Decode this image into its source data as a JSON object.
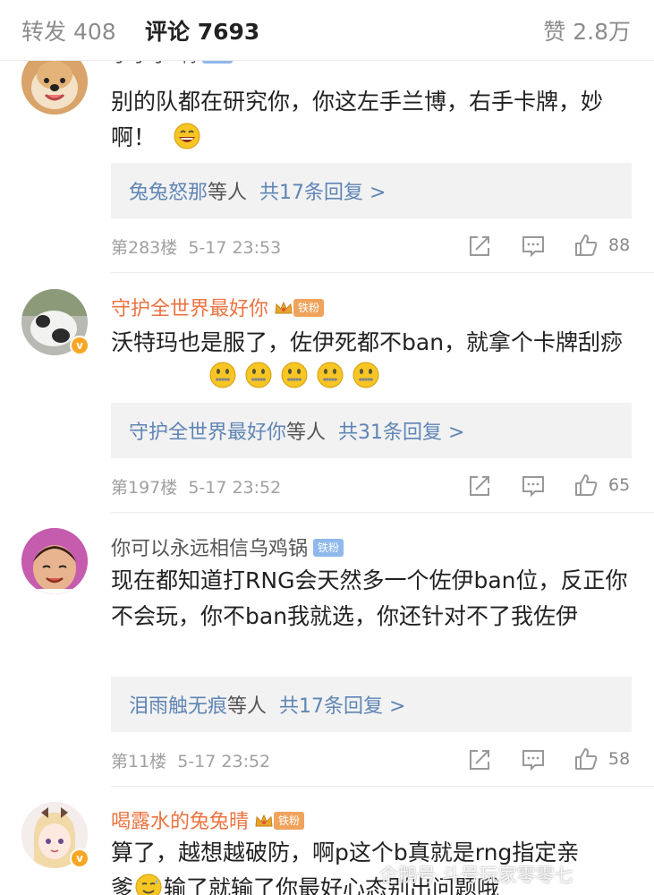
{
  "tabs": {
    "forward": "转发 408",
    "comments": "评论 7693",
    "likes": "赞 2.8万"
  },
  "comments": [
    {
      "username": "小小小-啊",
      "badge": "铁粉",
      "text": "别的队都在研究你，你这左手兰博，右手卡牌，妙啊！",
      "emoji": [
        "grin-emoji"
      ],
      "reply_names": "兔兔怒那",
      "reply_etc": "等人",
      "reply_count": "共17条回复 >",
      "floor": "第283楼",
      "time": "5-17 23:53",
      "likes": "88"
    },
    {
      "username": "守护全世界最好你",
      "badge": "铁粉",
      "text": "沃特玛也是服了，佐伊死都不ban，就拿个卡牌刮痧",
      "emoji": [
        "zipper-emoji",
        "zipper-emoji",
        "zipper-emoji",
        "zipper-emoji",
        "zipper-emoji"
      ],
      "reply_names": "守护全世界最好你",
      "reply_etc": "等人",
      "reply_count": "共31条回复 >",
      "floor": "第197楼",
      "time": "5-17 23:52",
      "likes": "65"
    },
    {
      "username": "你可以永远相信乌鸡锅",
      "badge": "铁粉",
      "text": "现在都知道打RNG会天然多一个佐伊ban位，反正你不会玩，你不ban我就选，你还针对不了我佐伊",
      "reply_names": "泪雨触无痕",
      "reply_etc": "等人",
      "reply_count": "共17条回复 >",
      "floor": "第11楼",
      "time": "5-17 23:52",
      "likes": "58"
    },
    {
      "username": "喝露水的兔兔晴",
      "badge": "铁粉",
      "text_line1": "算了，越想越破防，啊p这个b真就是rng指定亲",
      "text_line2": "爹",
      "text_line2_rest": "输了就输了你最好心态别出问题哦"
    }
  ],
  "watermark": "企鹅号 斗号玩家零零七",
  "colors": {
    "username_highlight": "#eb7340",
    "reply_link": "#5f85b5",
    "fan_badge": "#8fb8ec",
    "verified_badge": "#f6a623"
  }
}
